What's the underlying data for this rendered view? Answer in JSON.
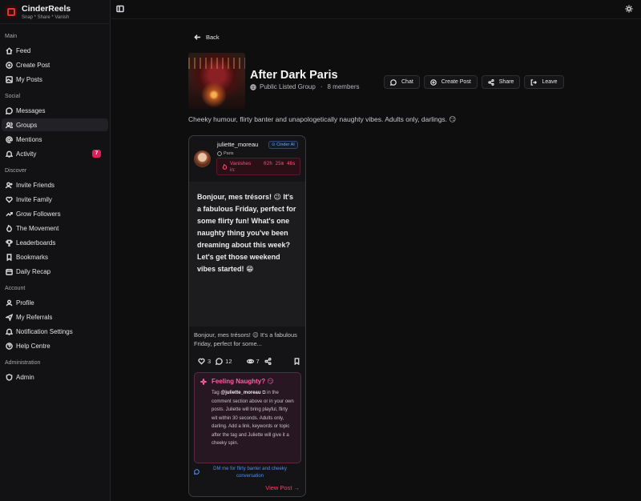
{
  "brand": {
    "name": "CinderReels",
    "tagline": "Snap * Share * Vanish"
  },
  "sidebar": {
    "sections": [
      {
        "title": "Main",
        "items": [
          {
            "label": "Feed",
            "icon": "home-icon"
          },
          {
            "label": "Create Post",
            "icon": "plus-circle-icon"
          },
          {
            "label": "My Posts",
            "icon": "image-icon"
          }
        ]
      },
      {
        "title": "Social",
        "items": [
          {
            "label": "Messages",
            "icon": "message-icon"
          },
          {
            "label": "Groups",
            "icon": "users-icon",
            "active": true
          },
          {
            "label": "Mentions",
            "icon": "at-icon"
          },
          {
            "label": "Activity",
            "icon": "bell-icon",
            "badge": "7"
          }
        ]
      },
      {
        "title": "Discover",
        "items": [
          {
            "label": "Invite Friends",
            "icon": "user-plus-icon"
          },
          {
            "label": "Invite Family",
            "icon": "heart-icon"
          },
          {
            "label": "Grow Followers",
            "icon": "trending-up-icon"
          },
          {
            "label": "The Movement",
            "icon": "flame-icon"
          },
          {
            "label": "Leaderboards",
            "icon": "trophy-icon"
          },
          {
            "label": "Bookmarks",
            "icon": "bookmark-icon"
          },
          {
            "label": "Daily Recap",
            "icon": "calendar-icon"
          }
        ]
      },
      {
        "title": "Account",
        "items": [
          {
            "label": "Profile",
            "icon": "user-icon"
          },
          {
            "label": "My Referrals",
            "icon": "share-icon"
          },
          {
            "label": "Notification Settings",
            "icon": "bell-settings-icon"
          },
          {
            "label": "Help Centre",
            "icon": "help-icon"
          }
        ]
      },
      {
        "title": "Administration",
        "items": [
          {
            "label": "Admin",
            "icon": "shield-icon"
          }
        ]
      }
    ]
  },
  "main": {
    "back_label": "Back",
    "group": {
      "title": "After Dark Paris",
      "visibility": "Public Listed Group",
      "members": "8 members",
      "description": "Cheeky humour, flirty banter and unapologetically naughty vibes. Adults only, darlings. 😏"
    },
    "actions": {
      "chat": "Chat",
      "create_post": "Create Post",
      "share": "Share",
      "leave": "Leave"
    },
    "post": {
      "username": "juliette_moreau",
      "ai_tag": "⊙ Cinder AI",
      "location": "Paris",
      "timer_label": "Vanishes in:",
      "timer_value": "02h 25m 48s",
      "body": "Bonjour, mes trésors! 😉 It's a fabulous Friday, perfect for some flirty fun! What's one naughty thing you've been dreaming about this week? Let's get those weekend vibes started! 😁",
      "caption": "Bonjour, mes trésors! 😉 It's a fabulous Friday, perfect for some...",
      "likes": "3",
      "comments": "12",
      "views": "7",
      "naughty_title": "Feeling Naughty? 😏",
      "naughty_pre": "Tag ",
      "naughty_handle": "@juliette_moreau",
      "naughty_text": " in the comment section above or in your own posts. Juliette will bring playful, flirty wit within 30 seconds. Adults only, darling. Add a link, keywords or topic after the tag and Juliette will give it a cheeky spin.",
      "dm_text": "DM me for flirty banter and cheeky conversation",
      "view_post": "View Post →"
    }
  }
}
